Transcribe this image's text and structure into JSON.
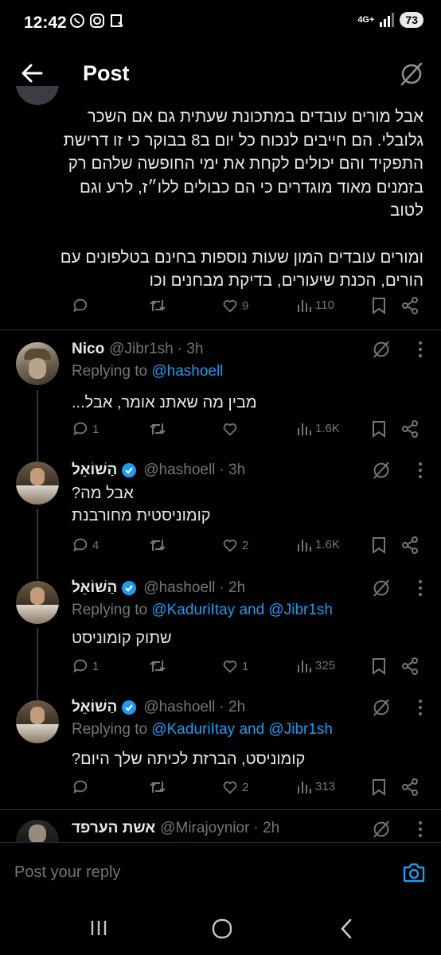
{
  "status_bar": {
    "time": "12:42",
    "network": "4G+",
    "battery": "73"
  },
  "header": {
    "title": "Post"
  },
  "main_post": {
    "paragraph1": "אבל מורים עובדים במתכונת שעתית גם אם השכר גלובלי. הם חייבים לנכוח כל יום ב8 בבוקר כי זו דרישת התפקיד והם יכולים לקחת את ימי החופשה שלהם רק בזמנים מאוד מוגדרים כי הם כבולים ללו״ז, לרע וגם לטוב",
    "paragraph2": "ומורים עובדים המון שעות נוספות בחינם בטלפונים עם הורים, הכנת שיעורים, בדיקת מבחנים וכו",
    "stats": {
      "replies": "",
      "reposts": "",
      "likes": "9",
      "views": "110"
    }
  },
  "replies": [
    {
      "name": "Nico",
      "handle": "@Jibr1sh",
      "time": "· 3h",
      "verified": false,
      "replying_label": "Replying to",
      "replying_to": "@hashoell",
      "text": "מבין מה שאתנ אומר, אבל...",
      "stats": {
        "replies": "1",
        "reposts": "",
        "likes": "",
        "views": "1.6K"
      }
    },
    {
      "name": "הַשׁוֹאֵל",
      "handle": "@hashoell",
      "time": "· 3h",
      "verified": true,
      "line1": "אבל מה?",
      "line2": "קומוניסטית מחורבנת",
      "stats": {
        "replies": "4",
        "reposts": "",
        "likes": "2",
        "views": "1.6K"
      }
    },
    {
      "name": "הַשׁוֹאֵל",
      "handle": "@hashoell",
      "time": "· 2h",
      "verified": true,
      "replying_label": "Replying to",
      "replying_to": "@KaduriItay and @Jibr1sh",
      "text": "שתוק קומוניסט",
      "stats": {
        "replies": "1",
        "reposts": "",
        "likes": "1",
        "views": "325"
      }
    },
    {
      "name": "הַשׁוֹאֵל",
      "handle": "@hashoell",
      "time": "· 2h",
      "verified": true,
      "replying_label": "Replying to",
      "replying_to": "@KaduriItay and @Jibr1sh",
      "text": "קומוניסט, הברזת לכיתה שלך היום?",
      "stats": {
        "replies": "",
        "reposts": "",
        "likes": "2",
        "views": "313"
      }
    },
    {
      "name": "אשת הערפד",
      "handle": "@Mirajoynior",
      "time": "· 2h"
    }
  ],
  "reply_bar": {
    "placeholder": "Post your reply"
  },
  "colors": {
    "background": "#000000",
    "text": "#e7e9ea",
    "muted": "#71767b",
    "accent": "#1d9bf0"
  }
}
